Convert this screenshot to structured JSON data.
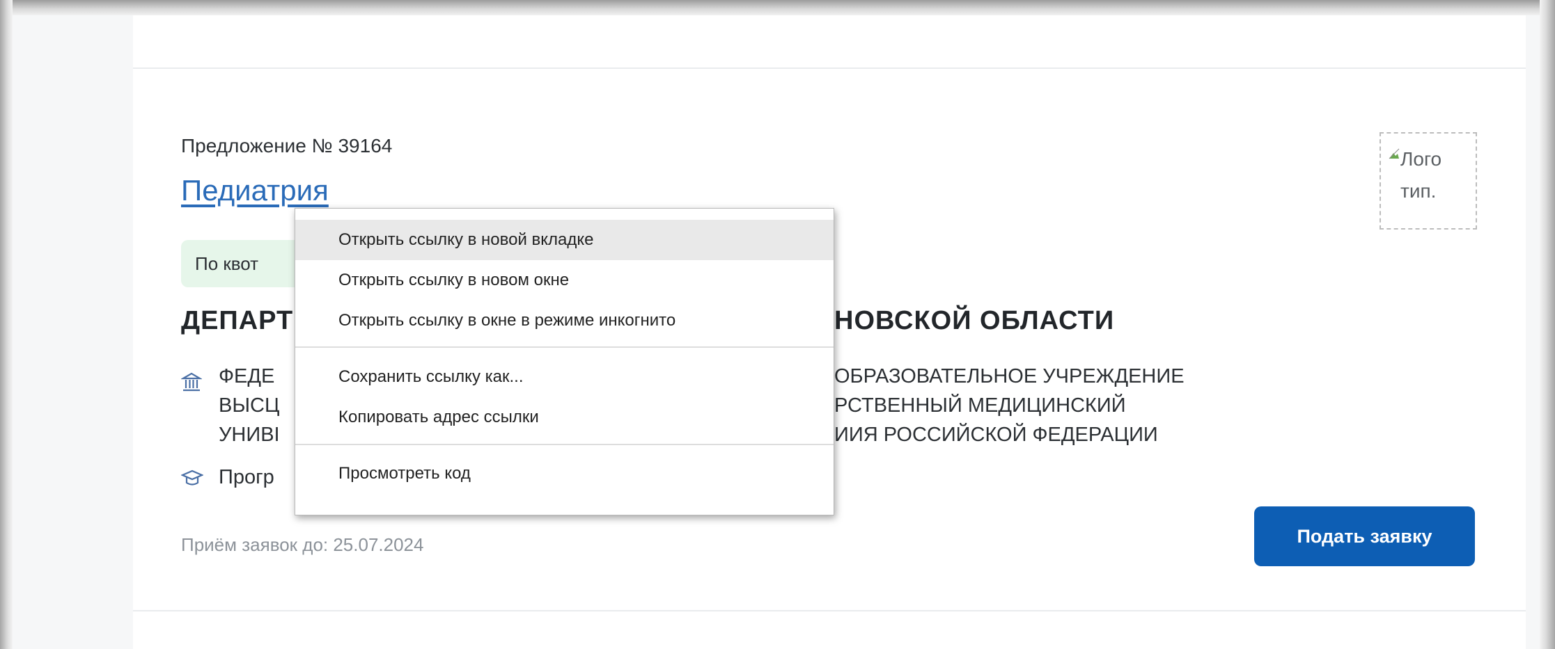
{
  "offer": {
    "number": "Предложение № 39164",
    "title": "Педиатрия",
    "badge": "По квот",
    "department_left": "ДЕПАРТ",
    "department_right": "НОВСКОЙ ОБЛАСТИ",
    "org_left": [
      "ФЕДЕ",
      "ВЫСЦ",
      "УНИВІ"
    ],
    "org_right": [
      "ОБРАЗОВАТЕЛЬНОЕ УЧРЕЖДЕНИЕ",
      "РСТВЕННЫЙ МЕДИЦИНСКИЙ",
      "ИИЯ РОССИЙСКОЙ ФЕДЕРАЦИИ"
    ],
    "program": "Прогр",
    "deadline": "Приём заявок до: 25.07.2024",
    "apply_label": "Подать заявку",
    "logo_alt": "Лого\nтип."
  },
  "context_menu": {
    "items": [
      "Открыть ссылку в новой вкладке",
      "Открыть ссылку в новом окне",
      "Открыть ссылку в окне в режиме инкогнито",
      "Сохранить ссылку как...",
      "Копировать адрес ссылки",
      "Просмотреть код"
    ],
    "hovered_index": 0
  },
  "icons": {
    "org": "building-columns-icon",
    "program": "graduation-cap-icon",
    "logo": "broken-image-icon"
  },
  "colors": {
    "link": "#2a6bb8",
    "button": "#0d5eb4",
    "badge_bg": "#e6f6ea",
    "menu_hover": "#e9e9e9"
  }
}
